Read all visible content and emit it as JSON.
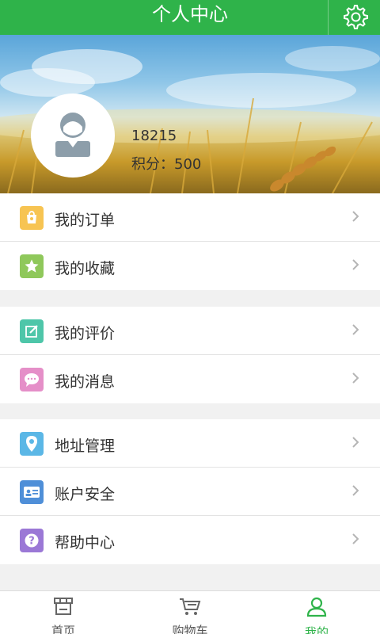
{
  "header": {
    "title": "个人中心",
    "settings_icon": "gear-icon"
  },
  "profile": {
    "phone": "18215",
    "points_text": "积分：500",
    "avatar_icon": "user-avatar-icon"
  },
  "menu": {
    "group1": [
      {
        "label": "我的订单",
        "icon": "order-bag-icon",
        "color": "#f7c452"
      },
      {
        "label": "我的收藏",
        "icon": "star-icon",
        "color": "#8fc85b"
      }
    ],
    "group2": [
      {
        "label": "我的评价",
        "icon": "edit-icon",
        "color": "#4ec6a9"
      },
      {
        "label": "我的消息",
        "icon": "message-icon",
        "color": "#e58fc8"
      }
    ],
    "group3": [
      {
        "label": "地址管理",
        "icon": "location-pin-icon",
        "color": "#5bb7e6"
      },
      {
        "label": "账户安全",
        "icon": "id-card-icon",
        "color": "#4f8fd8"
      },
      {
        "label": "帮助中心",
        "icon": "help-icon",
        "color": "#9b78d6"
      }
    ]
  },
  "tabbar": {
    "tabs": [
      {
        "label": "首页",
        "icon": "store-icon",
        "active": false
      },
      {
        "label": "购物车",
        "icon": "cart-icon",
        "active": false
      },
      {
        "label": "我的",
        "icon": "person-icon",
        "active": true
      }
    ]
  },
  "colors": {
    "primary": "#2fb34a",
    "text": "#333333",
    "chevron": "#b5b5b5"
  }
}
